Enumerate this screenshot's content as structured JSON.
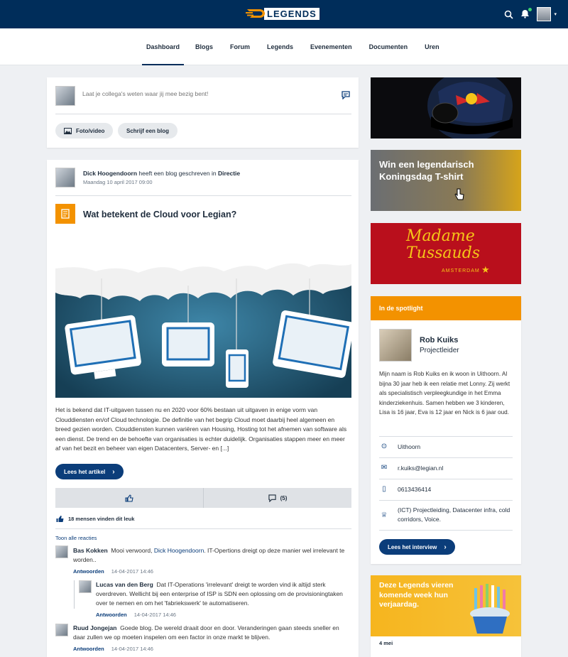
{
  "header": {
    "logo_text": "LEGENDS"
  },
  "nav": {
    "items": [
      "Dashboard",
      "Blogs",
      "Forum",
      "Legends",
      "Evenementen",
      "Documenten",
      "Uren"
    ],
    "active": "Dashboard"
  },
  "composer": {
    "placeholder": "Laat je collega's weten waar jij mee bezig bent!",
    "photo_label": "Foto/video",
    "blog_label": "Schrijf een blog"
  },
  "post": {
    "author": "Dick Hoogendoorn",
    "action": "heeft een blog geschreven in",
    "category": "Directie",
    "date": "Maandag 10 april 2017 09:00",
    "title": "Wat betekent de Cloud voor Legian?",
    "body": "Het is bekend dat IT-uitgaven tussen nu en 2020 voor 60% bestaan uit uitgaven in enige vorm van Clouddiensten en/of Cloud technologie. De definitie van het begrip Cloud moet daarbij heel algemeen en breed gezien worden. Clouddiensten kunnen variëren van Housing, Hosting tot het afnemen van software als een dienst. De trend en de behoefte van organisaties is echter duidelijk. Organisaties stappen meer en meer af van het bezit en beheer van eigen Datacenters, Server- en [...]",
    "read_more": "Lees het artikel",
    "comment_count": "(5)",
    "likes_text": "18 mensen vinden dit leuk",
    "show_all": "Toon alle reacties"
  },
  "comments": [
    {
      "name": "Bas Kokken",
      "text_before": "Mooi verwoord,",
      "mention": "Dick Hoogendoorn",
      "text_after": ". IT-Opertions dreigt op deze manier wel irrelevant te worden..",
      "reply": "Antwoorden",
      "date": "14-04-2017 14:46"
    },
    {
      "name": "Lucas van den Berg",
      "text": "Dat IT-Operations 'irrelevant' dreigt te worden vind ik altijd sterk overdreven. Wellicht bij een enterprise of ISP is SDN een oplossing om de provisioningtaken over te nemen en om het 'fabriekswerk' te automatiseren.",
      "reply": "Antwoorden",
      "date": "14-04-2017 14:46"
    },
    {
      "name": "Ruud Jongejan",
      "text": "Goede blog. De wereld draait door en door. Veranderingen gaan steeds sneller en daar zullen we op moeten inspelen om een factor in onze markt te blijven.",
      "reply": "Antwoorden",
      "date": "14-04-2017 14:46"
    }
  ],
  "banners": {
    "tshirt": "Win een legendarisch Koningsdag T-shirt",
    "tussauds_line1": "Madame",
    "tussauds_line2": "Tussauds",
    "tussauds_city": "AMSTERDAM"
  },
  "spotlight": {
    "header": "In de spotlight",
    "name": "Rob Kuiks",
    "role": "Projectleider",
    "bio": "Mijn naam is Rob Kuiks en ik woon in Uithoorn. Al bijna 30 jaar heb ik een relatie met Lonny. Zij werkt als specialistisch verpleegkundige in het Emma kinderziekenhuis. Samen hebben we 3 kinderen, Lisa is 16 jaar, Eva is 12 jaar en Nick is 6 jaar oud.",
    "location": "Uithoorn",
    "email": "r.kuiks@legian.nl",
    "phone": "0613436414",
    "expertise": "(ICT) Projectleiding, Datacenter infra, cold corridors, Voice.",
    "button": "Lees het interview"
  },
  "birthdays": {
    "title": "Deze Legends vieren komende week hun verjaardag.",
    "date": "4 mei"
  },
  "colors": {
    "navy": "#002d5a",
    "orange": "#f39200",
    "blue": "#0b3d7a"
  }
}
